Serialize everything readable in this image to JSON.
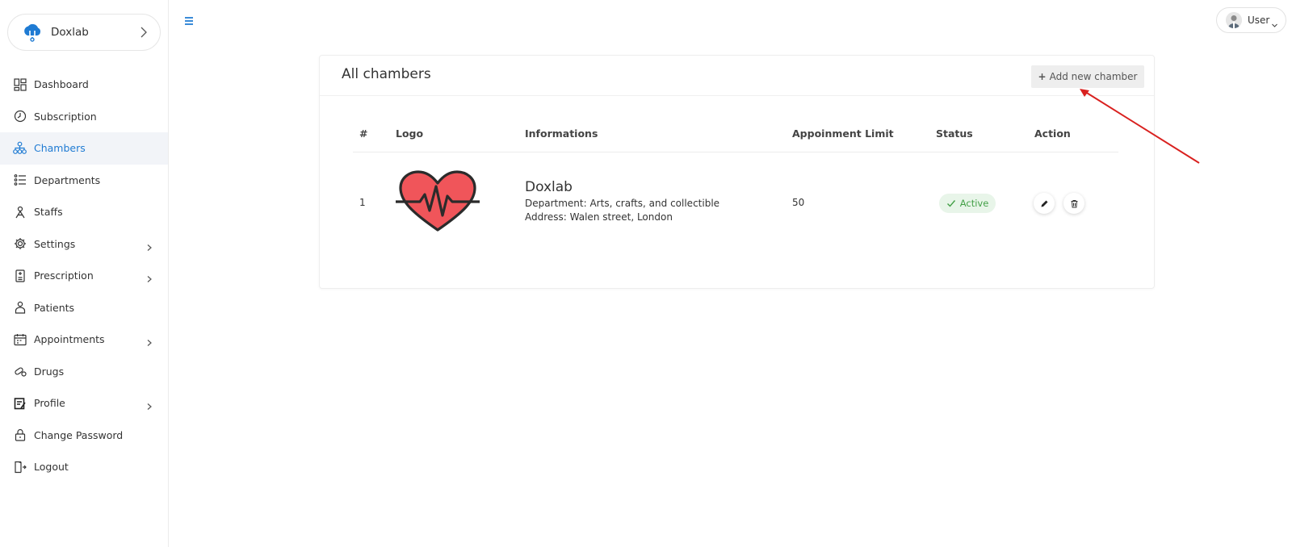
{
  "brand": {
    "name": "Doxlab"
  },
  "sidebar": {
    "items": [
      {
        "label": "Dashboard",
        "icon": "dashboard-icon",
        "active": false,
        "has_children": false
      },
      {
        "label": "Subscription",
        "icon": "clock-icon",
        "active": false,
        "has_children": false
      },
      {
        "label": "Chambers",
        "icon": "sitemap-icon",
        "active": true,
        "has_children": false
      },
      {
        "label": "Departments",
        "icon": "list-icon",
        "active": false,
        "has_children": false
      },
      {
        "label": "Staffs",
        "icon": "staff-icon",
        "active": false,
        "has_children": false
      },
      {
        "label": "Settings",
        "icon": "gear-icon",
        "active": false,
        "has_children": true
      },
      {
        "label": "Prescription",
        "icon": "prescription-icon",
        "active": false,
        "has_children": true
      },
      {
        "label": "Patients",
        "icon": "patient-icon",
        "active": false,
        "has_children": false
      },
      {
        "label": "Appointments",
        "icon": "calendar-icon",
        "active": false,
        "has_children": true
      },
      {
        "label": "Drugs",
        "icon": "pill-icon",
        "active": false,
        "has_children": false
      },
      {
        "label": "Profile",
        "icon": "profile-icon",
        "active": false,
        "has_children": true
      },
      {
        "label": "Change Password",
        "icon": "lock-icon",
        "active": false,
        "has_children": false
      },
      {
        "label": "Logout",
        "icon": "logout-icon",
        "active": false,
        "has_children": false
      }
    ]
  },
  "topbar": {
    "user_label": "User"
  },
  "card": {
    "title": "All chambers",
    "add_button_label": "Add new chamber"
  },
  "table": {
    "headers": {
      "num": "#",
      "logo": "Logo",
      "info": "Informations",
      "limit": "Appoinment Limit",
      "status": "Status",
      "action": "Action"
    },
    "rows": [
      {
        "num": "1",
        "name": "Doxlab",
        "department": "Department: Arts, crafts, and collectible",
        "address": "Address: Walen street, London",
        "limit": "50",
        "status": "Active"
      }
    ]
  },
  "colors": {
    "accent": "#1f7bd3",
    "heart": "#f0555a",
    "active_green": "#43a047",
    "arrow": "#d9211f"
  }
}
